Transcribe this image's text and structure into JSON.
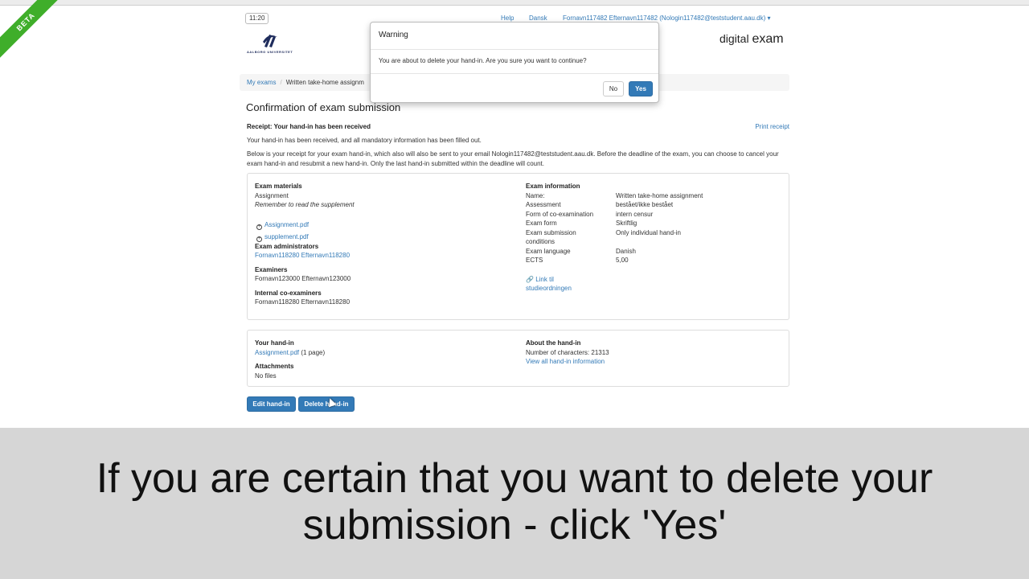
{
  "beta_label": "BETA",
  "time": "11:20",
  "top_nav": {
    "help": "Help",
    "language": "Dansk",
    "user": "Fornavn117482 Efternavn117482 (Nologin117482@teststudent.aau.dk) ▾"
  },
  "logo_text": "AALBORG UNIVERSITET",
  "brand": {
    "light": "digital",
    "bold": "exam"
  },
  "breadcrumb": {
    "home": "My exams",
    "current": "Written take-home assignm"
  },
  "page_title": "Confirmation of exam submission",
  "receipt_title": "Receipt: Your hand-in has been received",
  "print_receipt": "Print receipt",
  "para1": "Your hand-in has been received, and all mandatory information has been filled out.",
  "para2": "Below is your receipt for your exam hand-in, which also will also be sent to your email Nologin117482@teststudent.aau.dk. Before the deadline of the exam, you can choose to cancel your exam hand-in and resubmit a new hand-in. Only the last hand-in submitted within the deadline will count.",
  "exam_materials": {
    "heading": "Exam materials",
    "type": "Assignment",
    "note": "Remember to read the supplement",
    "files": [
      "Assignment.pdf",
      "supplement.pdf"
    ]
  },
  "exam_administrators": {
    "heading": "Exam administrators",
    "name": "Fornavn118280 Efternavn118280"
  },
  "examiners": {
    "heading": "Examiners",
    "name": "Fornavn123000 Efternavn123000"
  },
  "internal_coexaminers": {
    "heading": "Internal co-examiners",
    "name": "Fornavn118280 Efternavn118280"
  },
  "exam_information": {
    "heading": "Exam information",
    "rows": [
      {
        "k": "Name:",
        "v": "Written take-home assignment"
      },
      {
        "k": "Assessment",
        "v": "bestået/ikke bestået"
      },
      {
        "k": "Form of co-examination",
        "v": "intern censur"
      },
      {
        "k": "Exam form",
        "v": "Skriftlig"
      },
      {
        "k": "Exam submission",
        "v": "Only individual hand-in"
      },
      {
        "k": "conditions",
        "v": ""
      },
      {
        "k": "Exam language",
        "v": "Danish"
      },
      {
        "k": "ECTS",
        "v": "5,00"
      }
    ],
    "link_line1": "Link til",
    "link_line2": "studieordningen"
  },
  "your_handin": {
    "heading": "Your hand-in",
    "file": "Assignment.pdf",
    "pages": " (1 page)",
    "attachments_heading": "Attachments",
    "attachments_value": "No files"
  },
  "about_handin": {
    "heading": "About the hand-in",
    "chars": "Number of characters: 21313",
    "view_all": "View all hand-in information"
  },
  "buttons": {
    "edit": "Edit hand-in",
    "delete": "Delete hand-in"
  },
  "modal": {
    "title": "Warning",
    "body": "You are about to delete your hand-in. Are you sure you want to continue?",
    "no": "No",
    "yes": "Yes"
  },
  "caption_line1": "If you are certain that you want to delete your",
  "caption_line2": "submission - click 'Yes'"
}
